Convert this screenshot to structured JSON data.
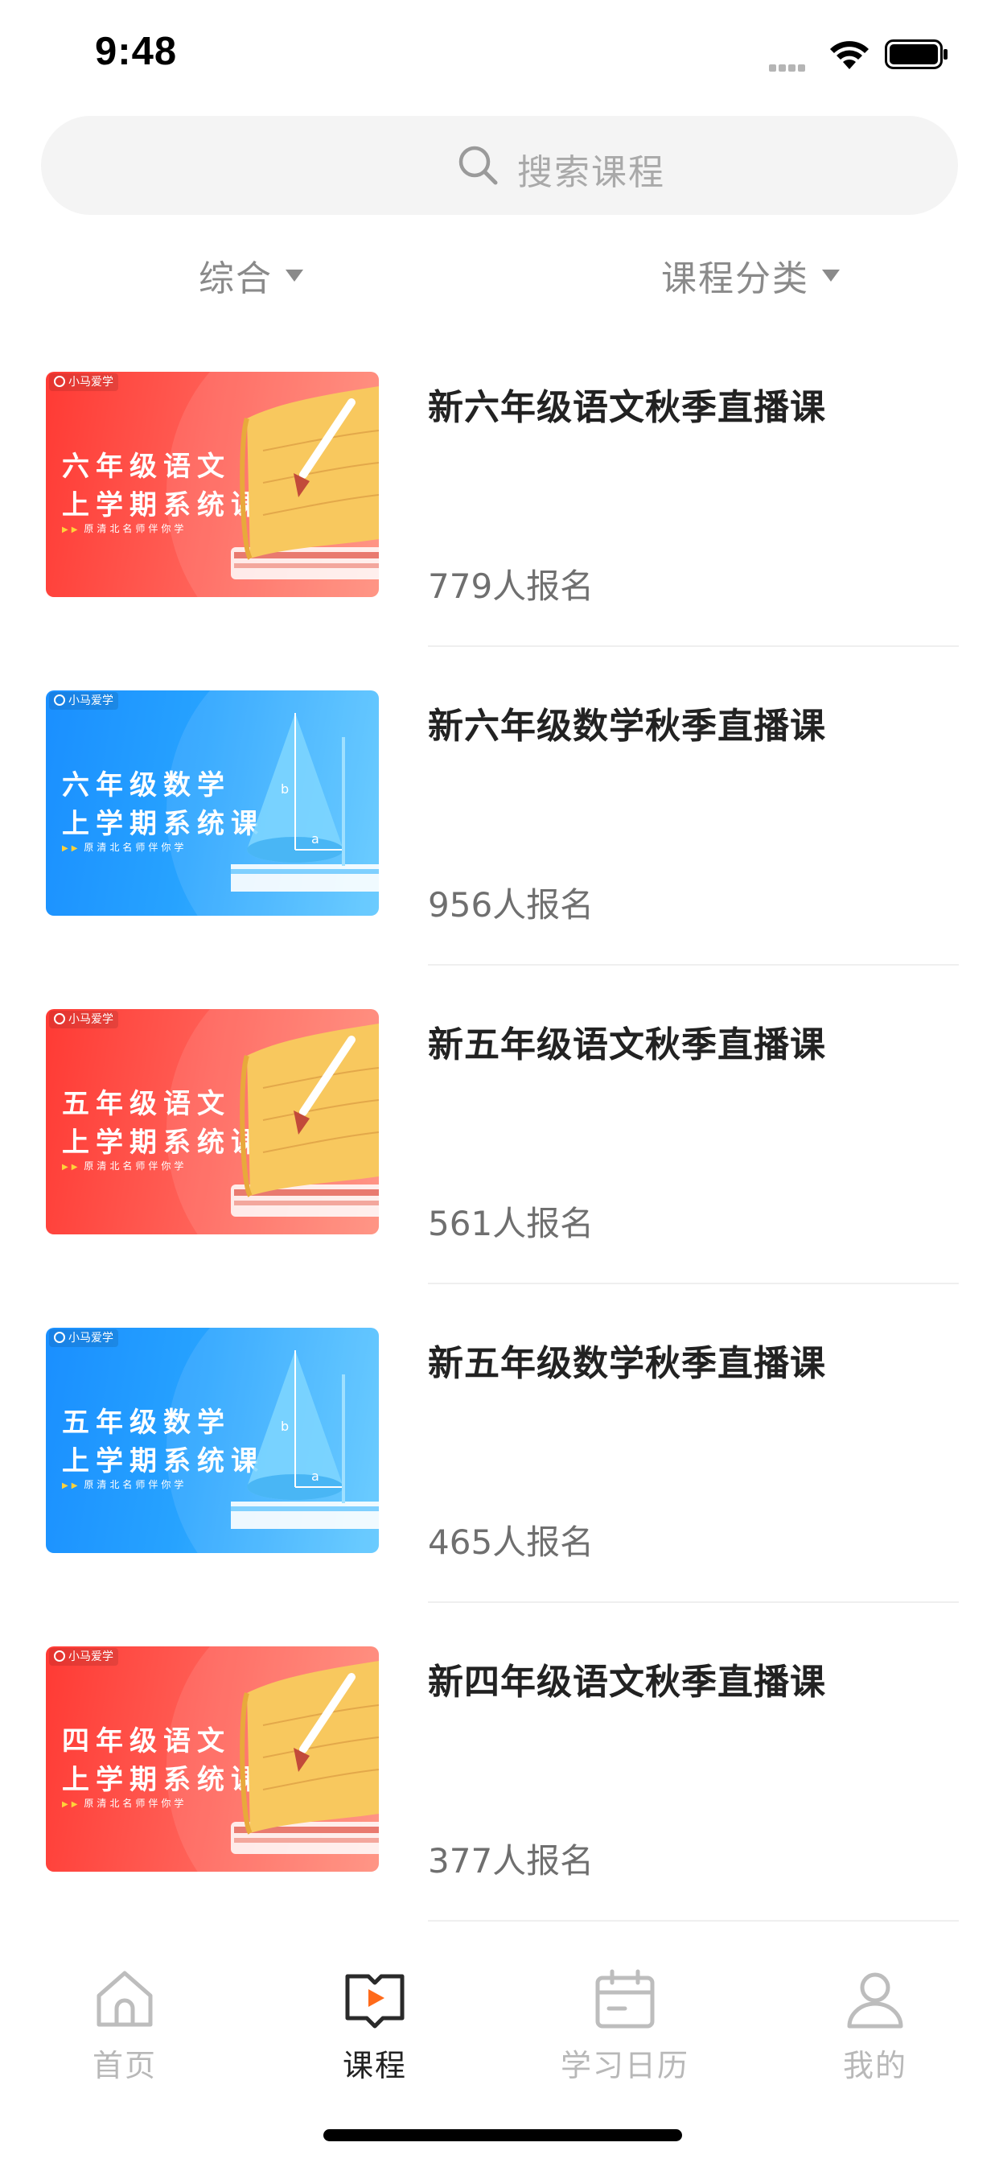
{
  "status_bar": {
    "time": "9:48"
  },
  "search": {
    "placeholder": "搜索课程"
  },
  "filters": {
    "sort_label": "综合",
    "category_label": "课程分类"
  },
  "courses": [
    {
      "title": "新六年级语文秋季直播课",
      "enrolled": "779人报名",
      "thumb_theme": "red",
      "thumb_brand": "小马爱学",
      "thumb_line1": "六年级语文",
      "thumb_line2": "上学期系统课",
      "thumb_tagline": "原清北名师伴你学"
    },
    {
      "title": "新六年级数学秋季直播课",
      "enrolled": "956人报名",
      "thumb_theme": "blue",
      "thumb_brand": "小马爱学",
      "thumb_line1": "六年级数学",
      "thumb_line2": "上学期系统课",
      "thumb_tagline": "原清北名师伴你学"
    },
    {
      "title": "新五年级语文秋季直播课",
      "enrolled": "561人报名",
      "thumb_theme": "red",
      "thumb_brand": "小马爱学",
      "thumb_line1": "五年级语文",
      "thumb_line2": "上学期系统课",
      "thumb_tagline": "原清北名师伴你学"
    },
    {
      "title": "新五年级数学秋季直播课",
      "enrolled": "465人报名",
      "thumb_theme": "blue",
      "thumb_brand": "小马爱学",
      "thumb_line1": "五年级数学",
      "thumb_line2": "上学期系统课",
      "thumb_tagline": "原清北名师伴你学"
    },
    {
      "title": "新四年级语文秋季直播课",
      "enrolled": "377人报名",
      "thumb_theme": "red",
      "thumb_brand": "小马爱学",
      "thumb_line1": "四年级语文",
      "thumb_line2": "上学期系统课",
      "thumb_tagline": "原清北名师伴你学"
    }
  ],
  "tab_bar": {
    "items": [
      {
        "label": "首页",
        "icon": "home-icon",
        "active": false
      },
      {
        "label": "课程",
        "icon": "course-icon",
        "active": true
      },
      {
        "label": "学习日历",
        "icon": "calendar-icon",
        "active": false
      },
      {
        "label": "我的",
        "icon": "user-icon",
        "active": false
      }
    ]
  },
  "colors": {
    "accent": "#ff6a1a",
    "active_tab_text": "#222222",
    "inactive_tab_text": "#b8b8b8",
    "red_banner": "#ff3a34",
    "blue_banner": "#1a8fff"
  }
}
